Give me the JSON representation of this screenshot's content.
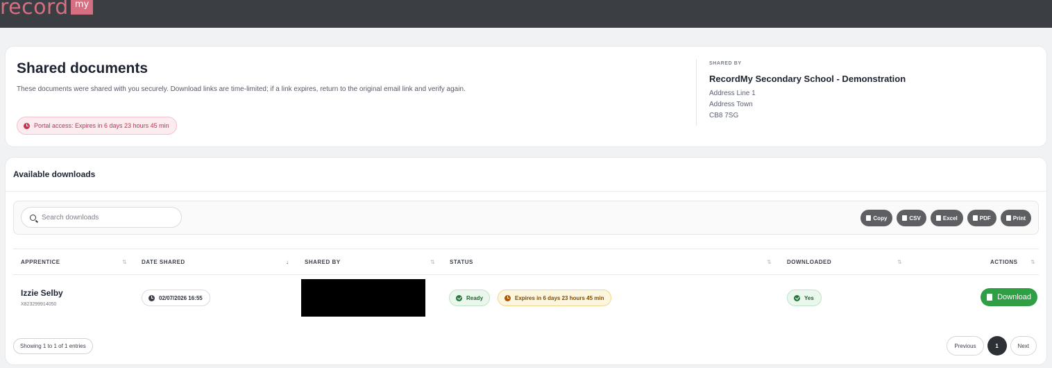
{
  "app": {
    "logo_text": "record",
    "logo_tag": "my"
  },
  "colors": {
    "brand": "#d66f82",
    "topbar": "#3b3e43",
    "success": "#2f9e44",
    "warning_bg": "#fdf6de",
    "danger_bg": "#fcecef"
  },
  "header": {
    "title": "Shared documents",
    "description": "These documents were shared with you securely. Download links are time-limited; if a link expires, return to the original email link and verify again.",
    "portal_access": "Portal access: Expires in 6 days 23 hours 45 min",
    "shared_by_label": "SHARED BY",
    "shared_by_name": "RecordMy Secondary School - Demonstration",
    "address_line_1": "Address Line 1",
    "address_town": "Address Town",
    "postcode": "CB8 7SG"
  },
  "downloads": {
    "title": "Available downloads",
    "search_placeholder": "Search downloads",
    "export_buttons": [
      "Copy",
      "CSV",
      "Excel",
      "PDF",
      "Print"
    ],
    "columns": {
      "apprentice": "APPRENTICE",
      "date_shared": "DATE SHARED",
      "shared_by": "SHARED BY",
      "status": "STATUS",
      "downloaded": "DOWNLOADED",
      "actions": "ACTIONS"
    },
    "rows": [
      {
        "apprentice_name": "Izzie Selby",
        "apprentice_id": "X823299914050",
        "date_shared": "02/07/2026 16:55",
        "status": "Ready",
        "expiry": "Expires in 6 days 23 hours 45 min",
        "downloaded": "Yes",
        "action": "Download"
      }
    ],
    "showing": "Showing 1 to 1 of 1 entries",
    "pagination": {
      "previous": "Previous",
      "current_page": "1",
      "next": "Next"
    }
  }
}
